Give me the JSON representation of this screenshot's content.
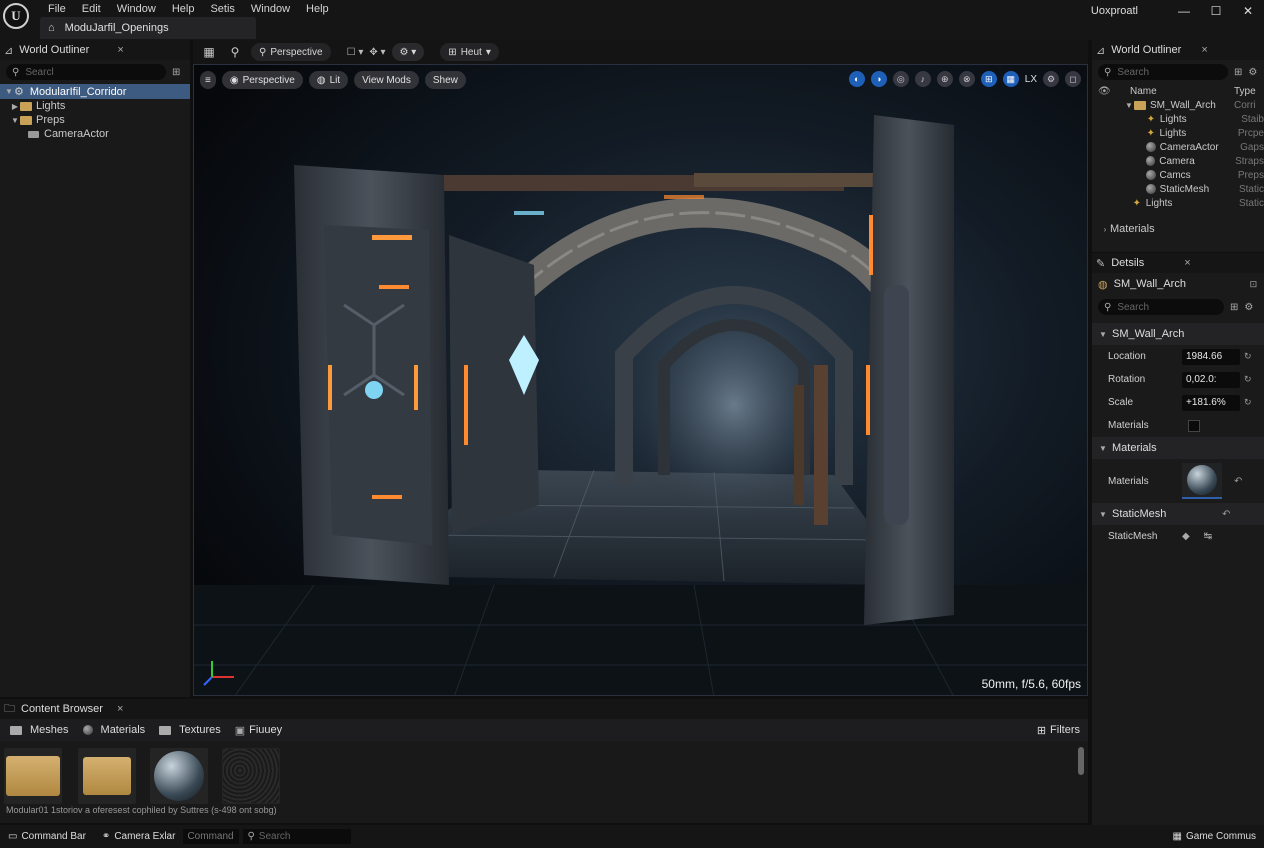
{
  "titlebar": {
    "menu": [
      "File",
      "Edit",
      "Window",
      "Help",
      "Setis",
      "Window",
      "Help"
    ],
    "project_tab": "ModuJarfil_Openings",
    "project_name": "Uoxproatl"
  },
  "world_outliner_left": {
    "tab": "World Outliner",
    "search_placeholder": "Searcl",
    "items": [
      {
        "label": "ModularIfil_Corridor"
      },
      {
        "label": "Lights"
      },
      {
        "label": "Preps"
      },
      {
        "label": "CameraActor"
      }
    ]
  },
  "viewport_toolbar": {
    "perspective": "Perspective",
    "hunt": "Heut"
  },
  "viewport": {
    "pill_perspective": "Perspective",
    "pill_lit": "Lit",
    "pill_viewmods": "View Mods",
    "pill_show": "Shew",
    "lx": "LX",
    "stats": "50mm, f/5.6, 60fps"
  },
  "world_outliner_right": {
    "tab": "World Outliner",
    "search_placeholder": "Search",
    "col_name": "Name",
    "col_type": "Type",
    "rows": [
      {
        "name": "SM_Wall_Arch",
        "type": "Corri"
      },
      {
        "name": "Lights",
        "type": "Staib"
      },
      {
        "name": "Lights",
        "type": "Prcpe"
      },
      {
        "name": "CameraActor",
        "type": "Gaps"
      },
      {
        "name": "Camera",
        "type": "Straps"
      },
      {
        "name": "Camcs",
        "type": "Preps"
      },
      {
        "name": "StaticMesh",
        "type": "Static"
      },
      {
        "name": "Lights",
        "type": "Static"
      }
    ],
    "materials_section": "Materials"
  },
  "details": {
    "tab": "Detsils",
    "object": "SM_Wall_Arch",
    "search_placeholder": "Search",
    "section": "SM_Wall_Arch",
    "location_label": "Location",
    "location_value": "1984.66",
    "rotation_label": "Rotation",
    "rotation_value": "0,02.0:",
    "scale_label": "Scale",
    "scale_value": "+181.6%",
    "materials_label": "Materials",
    "materials_section": "Materials",
    "materials_slot_label": "Materials",
    "staticmesh_section": "StaticMesh",
    "staticmesh_label": "StaticMesh"
  },
  "content_browser": {
    "tab": "Content Browser",
    "filters": [
      "Meshes",
      "Materials",
      "Textures",
      "Fiuuey"
    ],
    "filters_button": "Filters",
    "status": "Modular01 1storiov a oferesest cophiled by Suttres (s-498 ont sobg)"
  },
  "statusbar": {
    "command_bar": "Command Bar",
    "camera": "Camera Exlar",
    "command_placeholder": "Command",
    "search_placeholder": "Search",
    "right": "Game Commus"
  },
  "colors": {
    "accent": "#2f5fa8",
    "folder": "#c9a258",
    "selection": "#3d5a80"
  }
}
